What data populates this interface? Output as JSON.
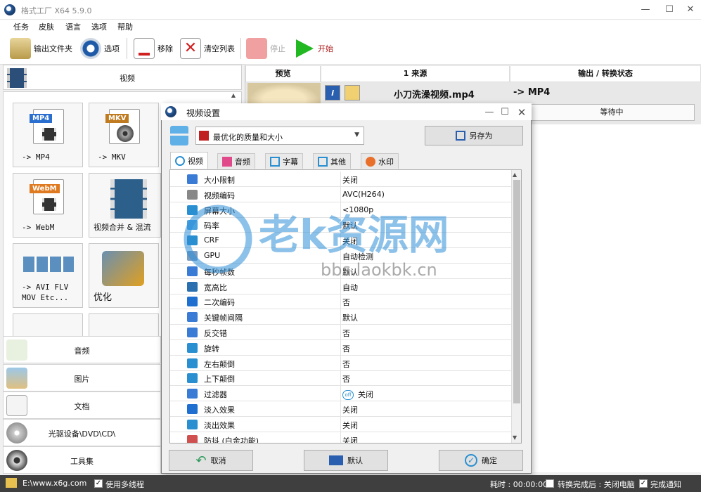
{
  "app": {
    "title": "格式工厂 X64 5.9.0"
  },
  "menu": [
    "任务",
    "皮肤",
    "语言",
    "选项",
    "帮助"
  ],
  "toolbar": {
    "output_folder": "输出文件夹",
    "options": "选项",
    "remove": "移除",
    "clear_list": "清空列表",
    "stop": "停止",
    "start": "开始"
  },
  "left": {
    "video_category": "视频",
    "tiles": [
      {
        "tag": "MP4",
        "label": "-> MP4"
      },
      {
        "tag": "MKV",
        "label": "-> MKV"
      },
      {
        "tag": "WebM",
        "label": "-> WebM"
      },
      {
        "tag": "",
        "label": "视频合并 & 混流"
      },
      {
        "tag": "",
        "label": "-> AVI FLV\nMOV Etc..."
      },
      {
        "tag": "",
        "label": "优化"
      }
    ],
    "categories": [
      "音频",
      "图片",
      "文档",
      "光驱设备\\DVD\\CD\\",
      "工具集"
    ]
  },
  "joblist": {
    "headers": [
      "预览",
      "1 来源",
      "输出 / 转换状态"
    ],
    "file": "小刀洗澡视频.mp4",
    "output": "-> MP4",
    "status": "等待中"
  },
  "dialog": {
    "title": "视频设置",
    "preset": "最优化的质量和大小",
    "save_as": "另存为",
    "tabs": [
      "视频",
      "音频",
      "字幕",
      "其他",
      "水印"
    ],
    "properties": [
      {
        "name": "大小限制",
        "value": "关闭",
        "color": "#3a7bd5"
      },
      {
        "name": "视频编码",
        "value": "AVC(H264)",
        "color": "#888888"
      },
      {
        "name": "屏幕大小",
        "value": "<1080p",
        "color": "#2a8fd0"
      },
      {
        "name": "码率",
        "value": "默认",
        "color": "#4aa3df"
      },
      {
        "name": "CRF",
        "value": "关闭",
        "color": "#2a8fd0"
      },
      {
        "name": "GPU",
        "value": "自动检测",
        "color": "#7a9cc0"
      },
      {
        "name": "每秒帧数",
        "value": "默认",
        "color": "#3a7bd5"
      },
      {
        "name": "宽高比",
        "value": "自动",
        "color": "#2a6fb0"
      },
      {
        "name": "二次编码",
        "value": "否",
        "color": "#1f6fd0"
      },
      {
        "name": "关键帧间隔",
        "value": "默认",
        "color": "#3a7bd5"
      },
      {
        "name": "反交错",
        "value": "否",
        "color": "#3a7bd5"
      },
      {
        "name": "旋转",
        "value": "否",
        "color": "#2a8fd0"
      },
      {
        "name": "左右颠倒",
        "value": "否",
        "color": "#2a8fd0"
      },
      {
        "name": "上下颠倒",
        "value": "否",
        "color": "#2a8fd0"
      },
      {
        "name": "过滤器",
        "value": "关闭",
        "color": "#3a7bd5",
        "badge": "off"
      },
      {
        "name": "淡入效果",
        "value": "关闭",
        "color": "#1f6fd0"
      },
      {
        "name": "淡出效果",
        "value": "关闭",
        "color": "#2a8fd0"
      },
      {
        "name": "防抖 (白金功能)",
        "value": "关闭",
        "color": "#d05050"
      }
    ],
    "cancel": "取消",
    "default": "默认",
    "ok": "确定"
  },
  "watermark": {
    "main": "老k资源网",
    "sub": "bbs.laokbk.cn"
  },
  "statusbar": {
    "path": "E:\\www.x6g.com",
    "multithread": "使用多线程",
    "elapsed": "耗时 : 00:00:00",
    "after_done": "转换完成后 : 关闭电脑",
    "notify": "完成通知"
  }
}
